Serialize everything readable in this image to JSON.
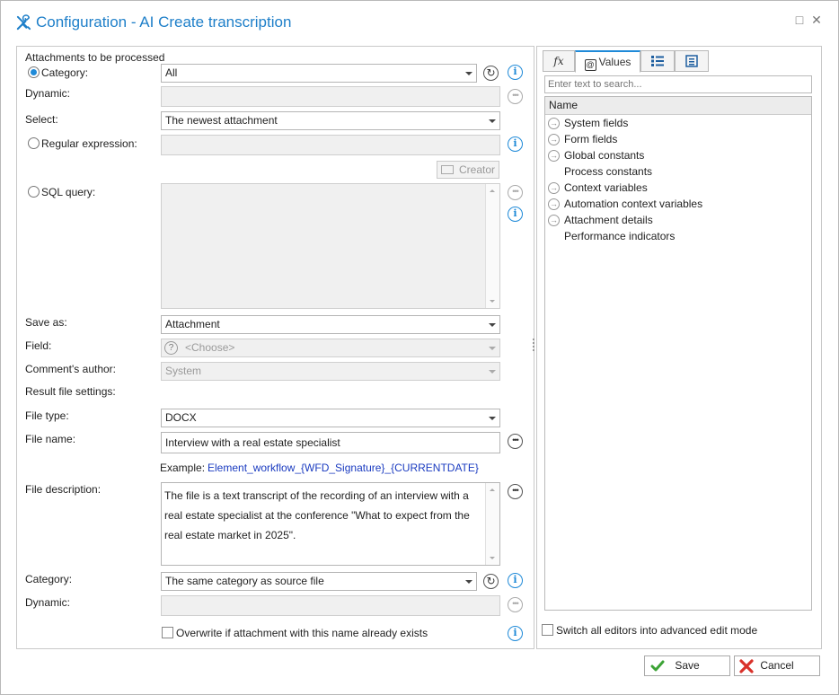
{
  "window": {
    "title": "Configuration - AI Create transcription",
    "maximize_glyph": "□",
    "close_glyph": "✕"
  },
  "left": {
    "section_attachments": "Attachments to be processed",
    "category_label": "Category:",
    "category_value": "All",
    "dynamic_label": "Dynamic:",
    "select_label": "Select:",
    "select_value": "The newest attachment",
    "regex_label": "Regular expression:",
    "creator_button": "Creator",
    "sql_label": "SQL query:",
    "save_as_label": "Save as:",
    "save_as_value": "Attachment",
    "field_label": "Field:",
    "field_value": "<Choose>",
    "author_label": "Comment's author:",
    "author_value": "System",
    "result_settings_label": "Result file settings:",
    "file_type_label": "File type:",
    "file_type_value": "DOCX",
    "file_name_label": "File name:",
    "file_name_value": "Interview with a real estate specialist",
    "example_label": "Example:",
    "example_value": "Element_workflow_{WFD_Signature}_{CURRENTDATE}",
    "file_description_label": "File description:",
    "file_description_value": "The file is a text transcript of the recording of an interview with a real estate specialist at the conference \"What to expect from the real estate market in 2025\".",
    "category2_label": "Category:",
    "category2_value": "The same category as source file",
    "dynamic2_label": "Dynamic:",
    "overwrite_label": "Overwrite if attachment with this name already exists"
  },
  "right": {
    "tab_fx": "fx",
    "tab_values": "Values",
    "search_placeholder": "Enter text to search...",
    "tree_header": "Name",
    "tree_items": [
      {
        "label": "System fields",
        "expandable": true
      },
      {
        "label": "Form fields",
        "expandable": true
      },
      {
        "label": "Global constants",
        "expandable": true
      },
      {
        "label": "Process constants",
        "expandable": false
      },
      {
        "label": "Context variables",
        "expandable": true
      },
      {
        "label": "Automation context variables",
        "expandable": true
      },
      {
        "label": "Attachment details",
        "expandable": true
      },
      {
        "label": "Performance indicators",
        "expandable": false
      }
    ],
    "advanced_mode_label": "Switch all editors into advanced edit mode"
  },
  "footer": {
    "save_label": "Save",
    "cancel_label": "Cancel"
  },
  "colors": {
    "accent": "#1f8ad8",
    "title": "#1e7fc9",
    "save_check": "#3ca336",
    "cancel_x": "#d9312a"
  }
}
